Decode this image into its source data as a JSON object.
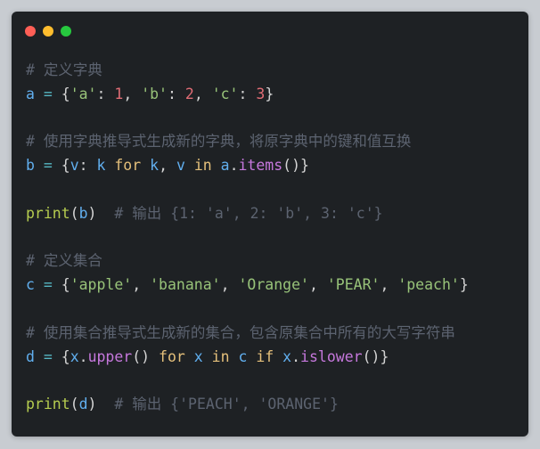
{
  "window": {
    "traffic_lights": {
      "close_color": "#ff5f56",
      "minimize_color": "#ffbd2e",
      "maximize_color": "#27c93f"
    }
  },
  "code": {
    "language": "python",
    "lines": [
      [
        {
          "t": "cm",
          "v": "# 定义字典"
        }
      ],
      [
        {
          "t": "var",
          "v": "a"
        },
        {
          "t": "op",
          "v": " = "
        },
        {
          "t": "pn",
          "v": "{"
        },
        {
          "t": "str",
          "v": "'a'"
        },
        {
          "t": "pn",
          "v": ": "
        },
        {
          "t": "num",
          "v": "1"
        },
        {
          "t": "pn",
          "v": ", "
        },
        {
          "t": "str",
          "v": "'b'"
        },
        {
          "t": "pn",
          "v": ": "
        },
        {
          "t": "num",
          "v": "2"
        },
        {
          "t": "pn",
          "v": ", "
        },
        {
          "t": "str",
          "v": "'c'"
        },
        {
          "t": "pn",
          "v": ": "
        },
        {
          "t": "num",
          "v": "3"
        },
        {
          "t": "pn",
          "v": "}"
        }
      ],
      [],
      [
        {
          "t": "cm",
          "v": "# 使用字典推导式生成新的字典，将原字典中的键和值互换"
        }
      ],
      [
        {
          "t": "var",
          "v": "b"
        },
        {
          "t": "op",
          "v": " = "
        },
        {
          "t": "pn",
          "v": "{"
        },
        {
          "t": "var",
          "v": "v"
        },
        {
          "t": "pn",
          "v": ": "
        },
        {
          "t": "var",
          "v": "k"
        },
        {
          "t": "pn",
          "v": " "
        },
        {
          "t": "kw",
          "v": "for"
        },
        {
          "t": "pn",
          "v": " "
        },
        {
          "t": "var",
          "v": "k"
        },
        {
          "t": "pn",
          "v": ", "
        },
        {
          "t": "var",
          "v": "v"
        },
        {
          "t": "pn",
          "v": " "
        },
        {
          "t": "kw",
          "v": "in"
        },
        {
          "t": "pn",
          "v": " "
        },
        {
          "t": "var",
          "v": "a"
        },
        {
          "t": "pn",
          "v": "."
        },
        {
          "t": "fn",
          "v": "items"
        },
        {
          "t": "pn",
          "v": "()}"
        }
      ],
      [],
      [
        {
          "t": "bi",
          "v": "print"
        },
        {
          "t": "pn",
          "v": "("
        },
        {
          "t": "var",
          "v": "b"
        },
        {
          "t": "pn",
          "v": ")  "
        },
        {
          "t": "cm",
          "v": "# 输出 {1: 'a', 2: 'b', 3: 'c'}"
        }
      ],
      [],
      [
        {
          "t": "cm",
          "v": "# 定义集合"
        }
      ],
      [
        {
          "t": "var",
          "v": "c"
        },
        {
          "t": "op",
          "v": " = "
        },
        {
          "t": "pn",
          "v": "{"
        },
        {
          "t": "str",
          "v": "'apple'"
        },
        {
          "t": "pn",
          "v": ", "
        },
        {
          "t": "str",
          "v": "'banana'"
        },
        {
          "t": "pn",
          "v": ", "
        },
        {
          "t": "str",
          "v": "'Orange'"
        },
        {
          "t": "pn",
          "v": ", "
        },
        {
          "t": "str",
          "v": "'PEAR'"
        },
        {
          "t": "pn",
          "v": ", "
        },
        {
          "t": "str",
          "v": "'peach'"
        },
        {
          "t": "pn",
          "v": "}"
        }
      ],
      [],
      [
        {
          "t": "cm",
          "v": "# 使用集合推导式生成新的集合，包含原集合中所有的大写字符串"
        }
      ],
      [
        {
          "t": "var",
          "v": "d"
        },
        {
          "t": "op",
          "v": " = "
        },
        {
          "t": "pn",
          "v": "{"
        },
        {
          "t": "var",
          "v": "x"
        },
        {
          "t": "pn",
          "v": "."
        },
        {
          "t": "fn",
          "v": "upper"
        },
        {
          "t": "pn",
          "v": "() "
        },
        {
          "t": "kw",
          "v": "for"
        },
        {
          "t": "pn",
          "v": " "
        },
        {
          "t": "var",
          "v": "x"
        },
        {
          "t": "pn",
          "v": " "
        },
        {
          "t": "kw",
          "v": "in"
        },
        {
          "t": "pn",
          "v": " "
        },
        {
          "t": "var",
          "v": "c"
        },
        {
          "t": "pn",
          "v": " "
        },
        {
          "t": "kw",
          "v": "if"
        },
        {
          "t": "pn",
          "v": " "
        },
        {
          "t": "var",
          "v": "x"
        },
        {
          "t": "pn",
          "v": "."
        },
        {
          "t": "fn",
          "v": "islower"
        },
        {
          "t": "pn",
          "v": "()}"
        }
      ],
      [],
      [
        {
          "t": "bi",
          "v": "print"
        },
        {
          "t": "pn",
          "v": "("
        },
        {
          "t": "var",
          "v": "d"
        },
        {
          "t": "pn",
          "v": ")  "
        },
        {
          "t": "cm",
          "v": "# 输出 {'PEACH', 'ORANGE'}"
        }
      ]
    ]
  }
}
